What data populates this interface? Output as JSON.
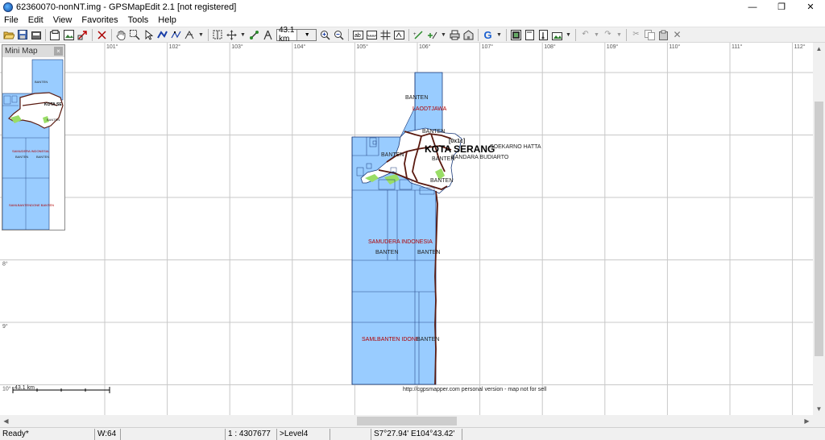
{
  "window": {
    "title": "62360070-nonNT.img - GPSMapEdit 2.1 [not registered]",
    "minimize": "—",
    "restore": "❐",
    "close": "✕"
  },
  "menu": [
    "File",
    "Edit",
    "View",
    "Favorites",
    "Tools",
    "Help"
  ],
  "toolbar": {
    "zoom_value": "43.1 km",
    "icons": [
      "open-icon",
      "save-icon",
      "save-as-icon",
      "properties-icon",
      "image-icon",
      "transform-icon",
      "hand-icon",
      "zoom-select-icon",
      "select-icon",
      "edit-nodes-icon",
      "create-polyline-icon",
      "create-polygon-icon",
      "ruler-icon",
      "zoom-in-icon",
      "zoom-out-icon",
      "labels-icon",
      "grid-icon",
      "google-icon",
      "undo-icon",
      "redo-icon",
      "cut-icon",
      "copy-icon",
      "paste-icon",
      "delete-icon"
    ]
  },
  "map": {
    "longitude_labels": [
      "101°",
      "102°",
      "103°",
      "104°",
      "105°",
      "106°",
      "107°",
      "108°",
      "109°",
      "110°",
      "111°",
      "112°"
    ],
    "latitude_labels": [
      "8°",
      "9°",
      "10°"
    ],
    "labels": {
      "banten_top": "BANTEN",
      "lodtjawa": "LAODTJAWA",
      "banten_2": "BANTEN",
      "code": "[0x1c]",
      "kota_serang": "KOTA SERANG",
      "soekarno_hatta": "SOEKARNO HATTA",
      "bandara": "BANDARA BUDIARTO",
      "banten_3": "BANTEN",
      "banten_4": "BANTEN",
      "banten_5": "BANTEN",
      "samudera": "SAMUDERA INDONESIA",
      "banten_6": "BANTEN",
      "banten_7": "BANTEN",
      "samlbanten": "SAMLBANTEN IDONE",
      "banten_8": "BANTEN",
      "copyright": "http://cgpsmapper.com personal version - map not for sell"
    },
    "scale_label": "43.1 km",
    "colors": {
      "water": "#99ccff",
      "land": "#ffffff",
      "grid": "#c8c8c8",
      "road": "#5a1a10",
      "green": "#99dd66"
    }
  },
  "minimap": {
    "title": "Mini Map",
    "close": "×",
    "labels": {
      "l1": "BANTEN",
      "l2": "KOTA SE",
      "l3": "BANTEN",
      "l4": "SAMUDERA INDONESIA",
      "l5": "BANTEN",
      "l6": "BANTEN",
      "l7": "SAMLBANTENDONE BANTEN"
    }
  },
  "statusbar": {
    "status": "Ready*",
    "w": "W:64",
    "scale": "1 : 4307677",
    "level": ">Level4",
    "coords": "S7°27.94' E104°43.42'"
  }
}
